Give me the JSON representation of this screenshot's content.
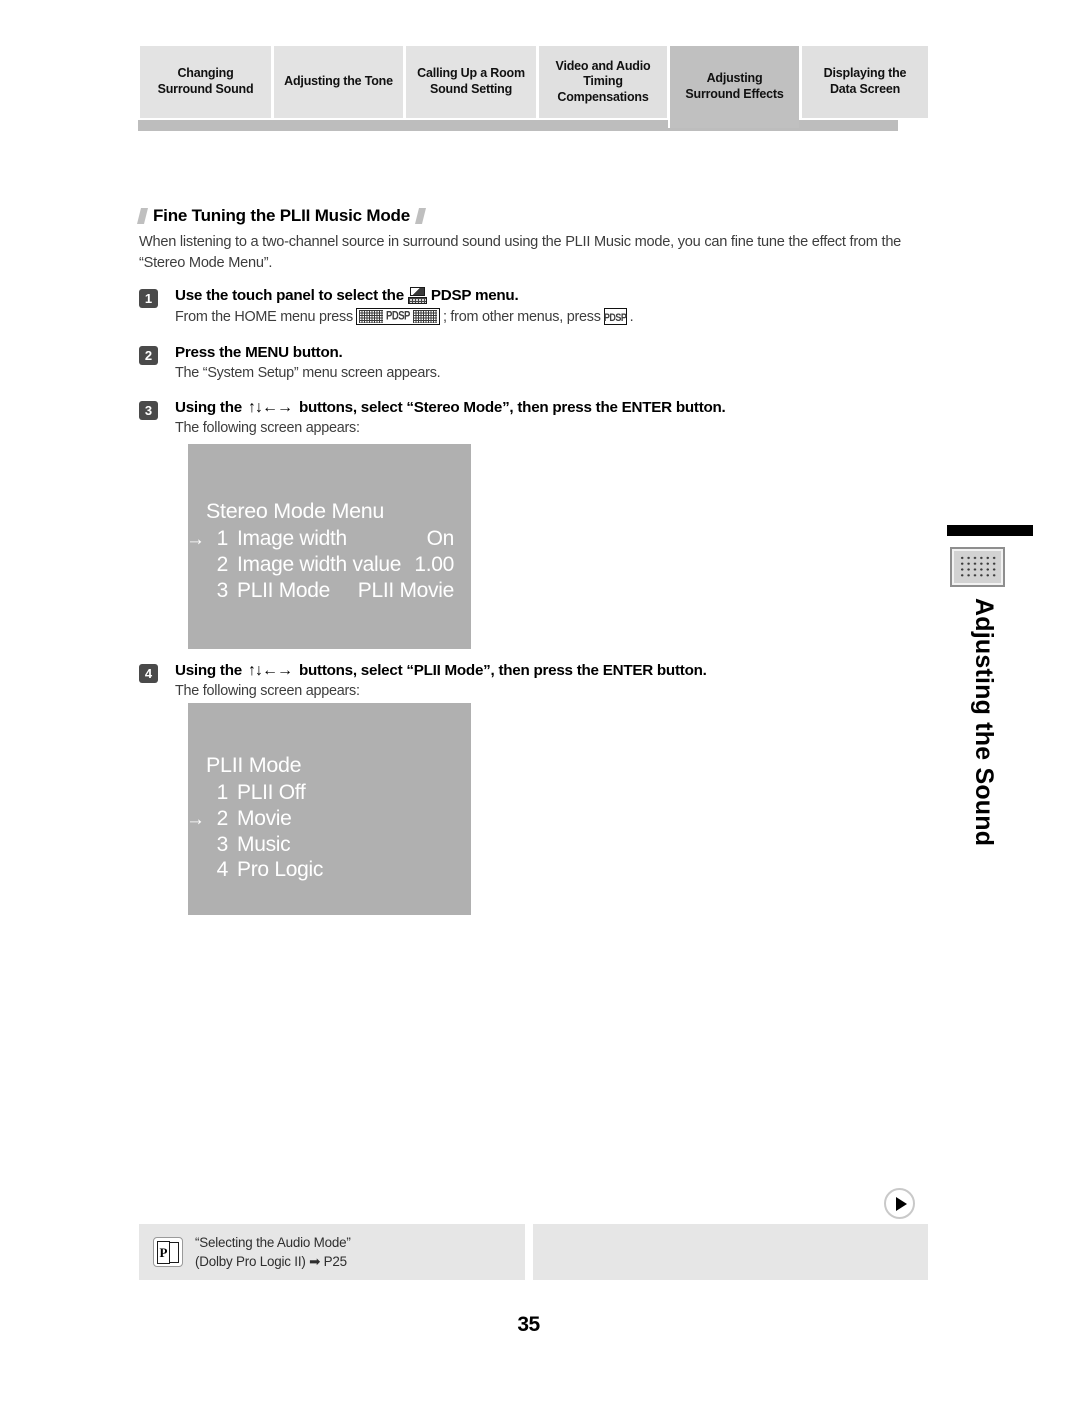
{
  "header": {
    "tabs": [
      {
        "lines": [
          "Changing",
          "Surround Sound"
        ],
        "active": false
      },
      {
        "lines": [
          "Adjusting the Tone"
        ],
        "active": false
      },
      {
        "lines": [
          "Calling Up a Room",
          "Sound Setting"
        ],
        "active": false
      },
      {
        "lines": [
          "Video and Audio",
          "Timing",
          "Compensations"
        ],
        "active": false
      },
      {
        "lines": [
          "Adjusting",
          "Surround Effects"
        ],
        "active": true
      },
      {
        "lines": [
          "Displaying the",
          "Data Screen"
        ],
        "active": false
      }
    ]
  },
  "section": {
    "title": "Fine Tuning the PLII Music Mode",
    "intro": "When listening to a two-channel source in surround sound using the PLII Music mode, you can fine tune the effect from the “Stereo Mode Menu”."
  },
  "steps": [
    {
      "number": "1",
      "title_before": "Use the touch panel to select the",
      "title_after": "PDSP menu.",
      "sub_before": "From the HOME menu press",
      "key_wide_label": "PDSP",
      "sub_middle": "; from other menus, press",
      "key_small_label": "PDSP",
      "sub_after": "."
    },
    {
      "number": "2",
      "title": "Press the MENU button.",
      "sub": "The “System Setup” menu screen appears."
    },
    {
      "number": "3",
      "title_before": "Using the",
      "arrows": "↑↓←→",
      "title_after": "buttons, select “Stereo Mode”, then press the ENTER button.",
      "sub": "The following screen appears:"
    },
    {
      "number": "4",
      "title_before": "Using the",
      "arrows": "↑↓←→",
      "title_after": "buttons, select “PLII Mode”, then press the ENTER button.",
      "sub": "The following screen appears:"
    }
  ],
  "osd_screens": [
    {
      "name": "stereo-mode-menu",
      "title": "Stereo Mode Menu",
      "rows": [
        {
          "cursor": "→",
          "num": "1",
          "label": "Image width",
          "value": "On"
        },
        {
          "cursor": "",
          "num": "2",
          "label": "Image width value",
          "value": "1.00"
        },
        {
          "cursor": "",
          "num": "3",
          "label": "PLII Mode",
          "value": "PLII Movie"
        }
      ]
    },
    {
      "name": "plii-mode-menu",
      "title": "PLII Mode",
      "rows": [
        {
          "cursor": "",
          "num": "1",
          "label": "PLII Off",
          "value": ""
        },
        {
          "cursor": "→",
          "num": "2",
          "label": "Movie",
          "value": ""
        },
        {
          "cursor": "",
          "num": "3",
          "label": "Music",
          "value": ""
        },
        {
          "cursor": "",
          "num": "4",
          "label": "Pro Logic",
          "value": ""
        }
      ]
    }
  ],
  "side_tab": {
    "label": "Adjusting the Sound"
  },
  "footer": {
    "reference": {
      "icon_letter": "P",
      "line1": "“Selecting the Audio Mode”",
      "line2": "(Dolby Pro Logic II) ➡ P25"
    },
    "page_number": "35"
  },
  "colors": {
    "tab_inactive": "#e3e3e3",
    "tab_active": "#c0c0c0",
    "osd_background": "#b0b0b0",
    "badge": "#4a4a4a"
  }
}
